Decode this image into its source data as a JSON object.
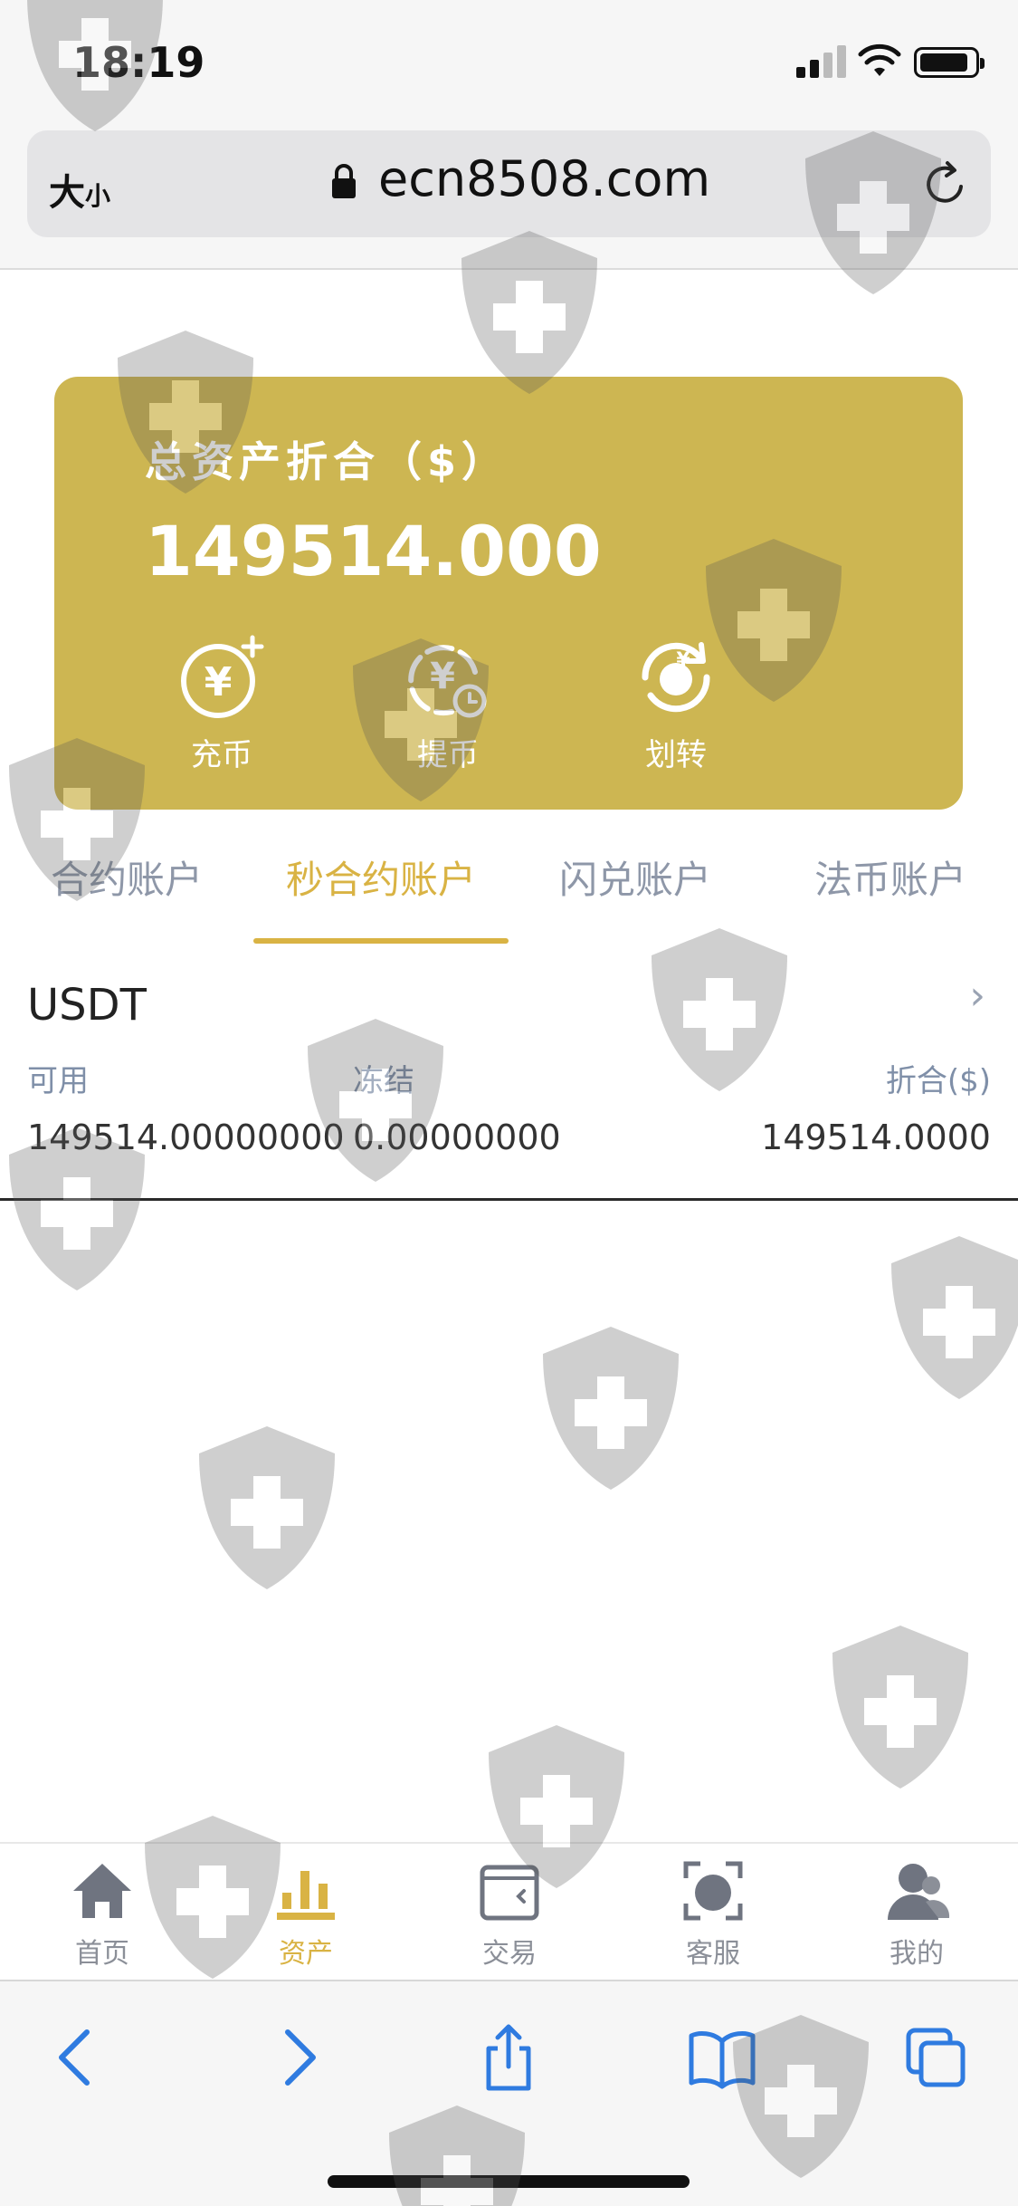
{
  "status_bar": {
    "time": "18:19"
  },
  "address_bar": {
    "text_size_big": "大",
    "text_size_small": "小",
    "url": "ecn8508.com"
  },
  "asset_card": {
    "title": "总资产折合（$）",
    "total": "149514.000",
    "actions": [
      {
        "label": "充币",
        "icon": "deposit-icon"
      },
      {
        "label": "提币",
        "icon": "withdraw-icon"
      },
      {
        "label": "划转",
        "icon": "transfer-icon"
      }
    ],
    "color": "#cdb652"
  },
  "tabs": [
    {
      "label": "合约账户",
      "active": false
    },
    {
      "label": "秒合约账户",
      "active": true
    },
    {
      "label": "闪兑账户",
      "active": false
    },
    {
      "label": "法币账户",
      "active": false
    }
  ],
  "coin": {
    "name": "USDT",
    "columns": [
      {
        "label": "可用",
        "value": "149514.00000000"
      },
      {
        "label": "冻结",
        "value": "0.00000000"
      },
      {
        "label": "折合($)",
        "value": "149514.0000"
      }
    ]
  },
  "bottom_nav": [
    {
      "label": "首页",
      "icon": "home-icon",
      "active": false
    },
    {
      "label": "资产",
      "icon": "assets-icon",
      "active": true
    },
    {
      "label": "交易",
      "icon": "wallet-icon",
      "active": false
    },
    {
      "label": "客服",
      "icon": "support-icon",
      "active": false
    },
    {
      "label": "我的",
      "icon": "profile-icon",
      "active": false
    }
  ],
  "accent_color": "#d9b344"
}
